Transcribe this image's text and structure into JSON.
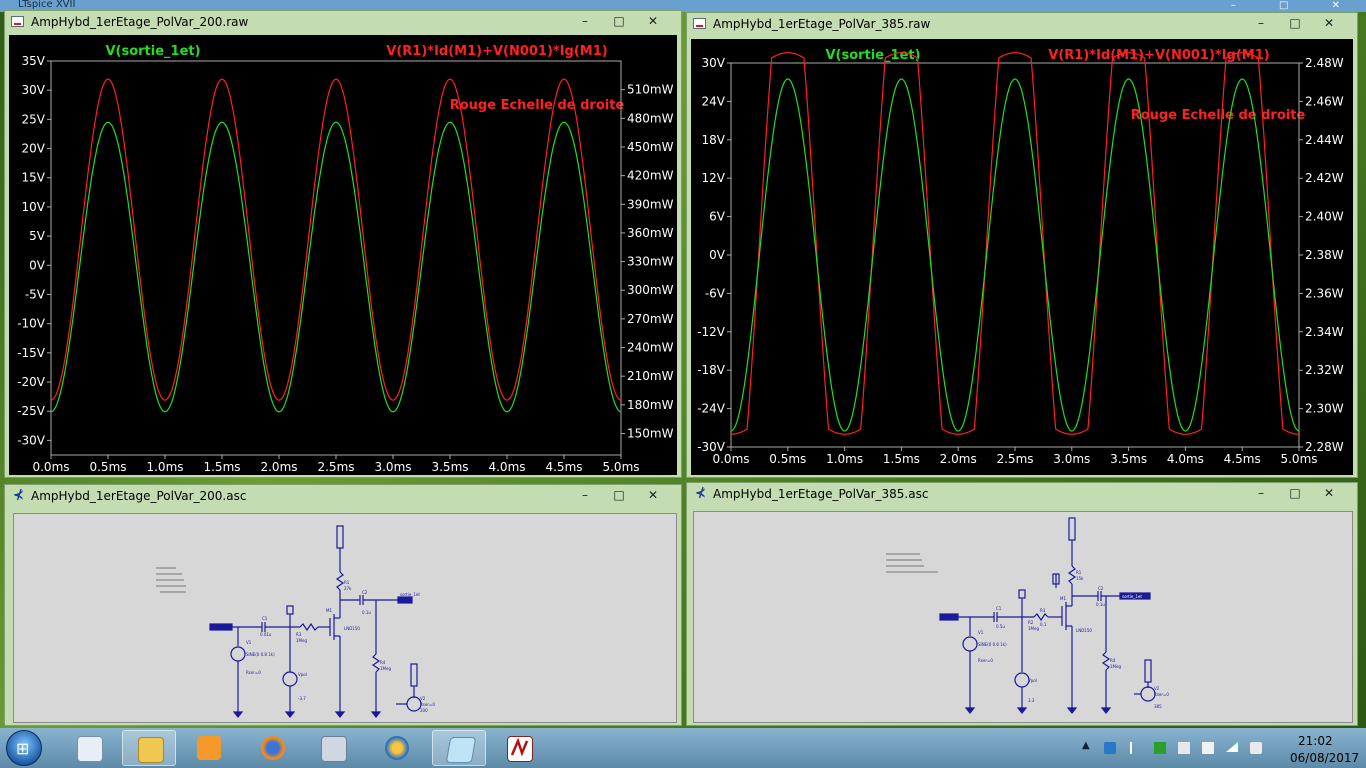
{
  "background_window_title": "LTspice XVII",
  "windows": {
    "plot1": {
      "title": "AmpHybd_1erEtage_PolVar_200.raw",
      "trace_green_label": "V(sortie_1et)",
      "trace_red_label": "V(R1)*Id(M1)+V(N001)*Ig(M1)",
      "note": "Rouge Echelle de droite",
      "left_ticks": [
        "35V",
        "30V",
        "25V",
        "20V",
        "15V",
        "10V",
        "5V",
        "0V",
        "-5V",
        "-10V",
        "-15V",
        "-20V",
        "-25V",
        "-30V"
      ],
      "right_ticks": [
        "510mW",
        "480mW",
        "450mW",
        "420mW",
        "390mW",
        "360mW",
        "330mW",
        "300mW",
        "270mW",
        "240mW",
        "210mW",
        "180mW",
        "150mW"
      ],
      "x_ticks": [
        "0.0ms",
        "0.5ms",
        "1.0ms",
        "1.5ms",
        "2.0ms",
        "2.5ms",
        "3.0ms",
        "3.5ms",
        "4.0ms",
        "4.5ms",
        "5.0ms"
      ]
    },
    "plot2": {
      "title": "AmpHybd_1erEtage_PolVar_385.raw",
      "trace_green_label": "V(sortie_1et)",
      "trace_red_label": "V(R1)*Id(M1)+V(N001)*Ig(M1)",
      "note": "Rouge Echelle de droite",
      "left_ticks": [
        "30V",
        "24V",
        "18V",
        "12V",
        "6V",
        "0V",
        "-6V",
        "-12V",
        "-18V",
        "-24V",
        "-30V"
      ],
      "right_ticks": [
        "2.48W",
        "2.46W",
        "2.44W",
        "2.42W",
        "2.40W",
        "2.38W",
        "2.36W",
        "2.34W",
        "2.32W",
        "2.30W",
        "2.28W"
      ],
      "x_ticks": [
        "0.0ms",
        "0.5ms",
        "1.0ms",
        "1.5ms",
        "2.0ms",
        "2.5ms",
        "3.0ms",
        "3.5ms",
        "4.0ms",
        "4.5ms",
        "5.0ms"
      ]
    },
    "schem1": {
      "title": "AmpHybd_1erEtage_PolVar_200.asc"
    },
    "schem2": {
      "title": "AmpHybd_1erEtage_PolVar_385.asc"
    }
  },
  "window_buttons": {
    "minimize": "–",
    "maximize": "□",
    "close": "✕"
  },
  "taskbar": {
    "items": [
      "start",
      "notepad",
      "explorer",
      "media-player",
      "firefox",
      "calculator",
      "compass",
      "notes",
      "ltspice"
    ],
    "active": [
      "explorer",
      "notes"
    ]
  },
  "clock": {
    "time": "21:02",
    "date": "06/08/2017"
  },
  "colors": {
    "green_trace": "#22dd22",
    "red_trace": "#ff2020",
    "plot_bg": "#000000",
    "axis_text": "#ffffff",
    "wire": "#1a1a9a"
  }
}
